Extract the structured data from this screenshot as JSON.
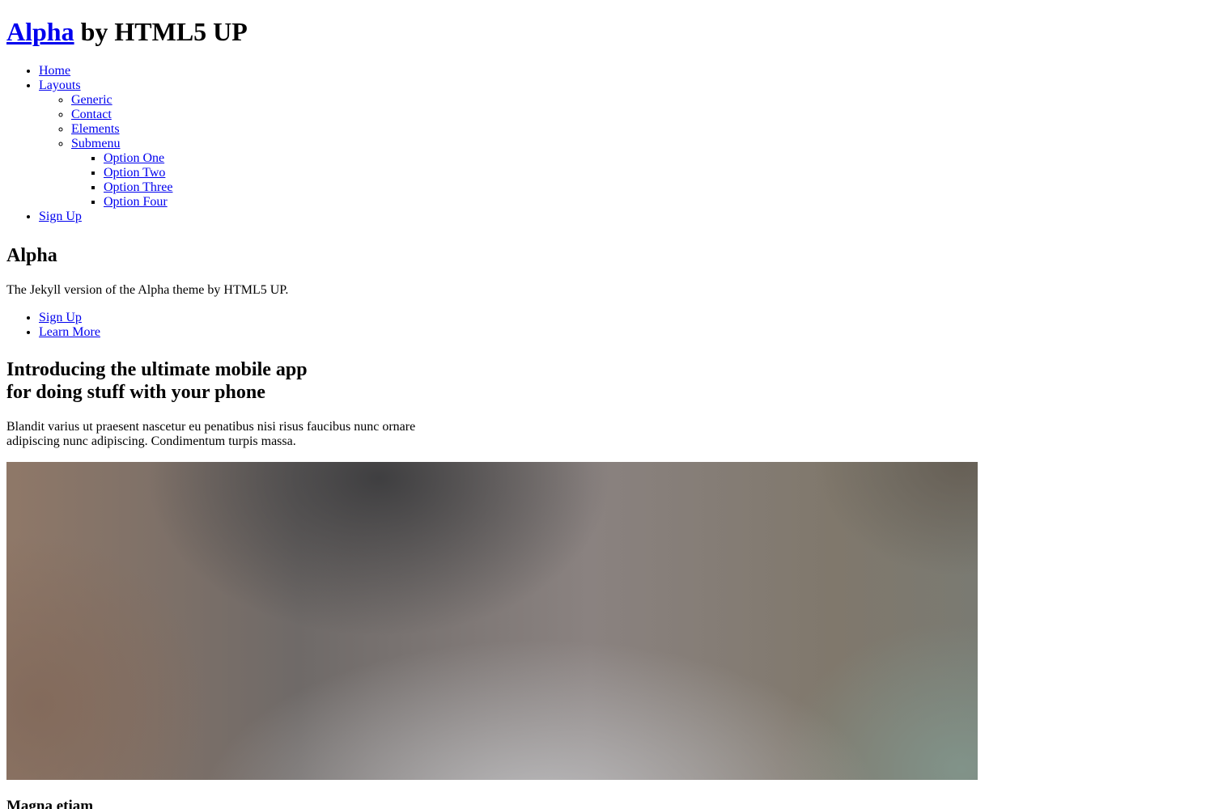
{
  "header": {
    "brand_link": "Alpha",
    "brand_suffix": "by HTML5 UP"
  },
  "nav": {
    "home": "Home",
    "layouts": "Layouts",
    "layouts_items": {
      "generic": "Generic",
      "contact": "Contact",
      "elements": "Elements",
      "submenu": "Submenu",
      "submenu_items": [
        "Option One",
        "Option Two",
        "Option Three",
        "Option Four"
      ]
    },
    "sign_up": "Sign Up"
  },
  "banner": {
    "title": "Alpha",
    "subtitle": "The Jekyll version of the Alpha theme by HTML5 UP.",
    "actions": [
      "Sign Up",
      "Learn More"
    ]
  },
  "intro": {
    "title_line1": "Introducing the ultimate mobile app",
    "title_line2": "for doing stuff with your phone",
    "text_line1": "Blandit varius ut praesent nascetur eu penatibus nisi risus faucibus nunc ornare",
    "text_line2": "adipiscing nunc adipiscing. Condimentum turpis massa."
  },
  "section": {
    "title": "Magna etiam"
  }
}
